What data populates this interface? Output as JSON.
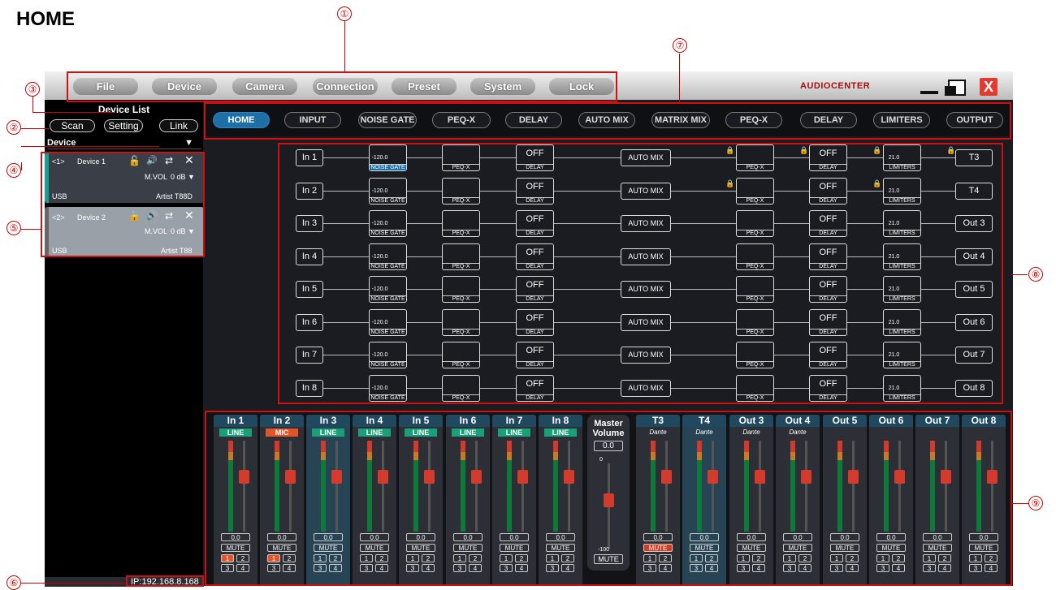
{
  "doc_title": "HOME",
  "callouts": [
    "①",
    "②",
    "③",
    "④",
    "⑤",
    "⑥",
    "⑦",
    "⑧",
    "⑨"
  ],
  "menu": [
    "File",
    "Device",
    "Camera",
    "Connection",
    "Preset",
    "System",
    "Lock"
  ],
  "logo": "AUDIOCENTER",
  "sidebar": {
    "title": "Device List",
    "scan": "Scan",
    "setting": "Setting",
    "link": "Link",
    "device_header": "Device",
    "devices": [
      {
        "index": "<1>",
        "name": "Device 1",
        "mvol": "M.VOL",
        "db": "0 dB ▼",
        "conn": "USB",
        "model": "Artist T88D"
      },
      {
        "index": "<2>",
        "name": "Device 2",
        "mvol": "M.VOL",
        "db": "0 dB ▼",
        "conn": "USB",
        "model": "Artist T88"
      }
    ],
    "ip": "IP:192.168.8.168"
  },
  "tabs": [
    "HOME",
    "INPUT",
    "NOISE GATE",
    "PEQ-X",
    "DELAY",
    "AUTO MIX",
    "MATRIX MIX",
    "PEQ-X",
    "DELAY",
    "LIMITERS",
    "OUTPUT"
  ],
  "routing": {
    "inputs": [
      "In 1",
      "In 2",
      "In 3",
      "In 4",
      "In 5",
      "In 6",
      "In 7",
      "In 8"
    ],
    "outputs": [
      "T3",
      "T4",
      "Out 3",
      "Out 4",
      "Out 5",
      "Out 6",
      "Out 7",
      "Out 8"
    ],
    "gate_value": "-120.0",
    "gate_label": "NOISE GATE",
    "peq_label": "PEQ-X",
    "delay_value": "OFF",
    "delay_label": "DELAY",
    "automix_label": "AUTO MIX",
    "limiter_value": "21.0",
    "limiter_label": "LIMITERS"
  },
  "mixer": {
    "inputs": [
      {
        "name": "In 1",
        "src": "LINE",
        "val": "0.0",
        "mute": "MUTE",
        "btn1_active": true
      },
      {
        "name": "In 2",
        "src": "MIC",
        "val": "0.0",
        "mute": "MUTE",
        "btn1_active": true
      },
      {
        "name": "In 3",
        "src": "LINE",
        "val": "0.0",
        "mute": "MUTE",
        "btn1_active": false
      },
      {
        "name": "In 4",
        "src": "LINE",
        "val": "0.0",
        "mute": "MUTE",
        "btn1_active": false
      },
      {
        "name": "In 5",
        "src": "LINE",
        "val": "0.0",
        "mute": "MUTE",
        "btn1_active": false
      },
      {
        "name": "In 6",
        "src": "LINE",
        "val": "0.0",
        "mute": "MUTE",
        "btn1_active": false
      },
      {
        "name": "In 7",
        "src": "LINE",
        "val": "0.0",
        "mute": "MUTE",
        "btn1_active": false
      },
      {
        "name": "In 8",
        "src": "LINE",
        "val": "0.0",
        "mute": "MUTE",
        "btn1_active": false
      }
    ],
    "master": {
      "title": "Master",
      "title2": "Volume",
      "val": "0.0",
      "top": "0",
      "bottom": "-100",
      "mute": "MUTE"
    },
    "outputs": [
      {
        "name": "T3",
        "src": "Dante",
        "val": "0.0",
        "mute": "MUTE",
        "muted": true
      },
      {
        "name": "T4",
        "src": "Dante",
        "val": "0.0",
        "mute": "MUTE",
        "muted": false
      },
      {
        "name": "Out 3",
        "src": "Dante",
        "val": "0.0",
        "mute": "MUTE",
        "muted": false
      },
      {
        "name": "Out 4",
        "src": "Dante",
        "val": "0.0",
        "mute": "MUTE",
        "muted": false
      },
      {
        "name": "Out 5",
        "src": "",
        "val": "0.0",
        "mute": "MUTE",
        "muted": false
      },
      {
        "name": "Out 6",
        "src": "",
        "val": "0.0",
        "mute": "MUTE",
        "muted": false
      },
      {
        "name": "Out 7",
        "src": "",
        "val": "0.0",
        "mute": "MUTE",
        "muted": false
      },
      {
        "name": "Out 8",
        "src": "",
        "val": "0.0",
        "mute": "MUTE",
        "muted": false
      }
    ],
    "btn_labels": [
      "1",
      "2",
      "3",
      "4"
    ]
  },
  "colors": {
    "accent": "#1d6fa5",
    "line": "#1aa079",
    "mic": "#e2552a",
    "mute_on": "#d93a20"
  }
}
